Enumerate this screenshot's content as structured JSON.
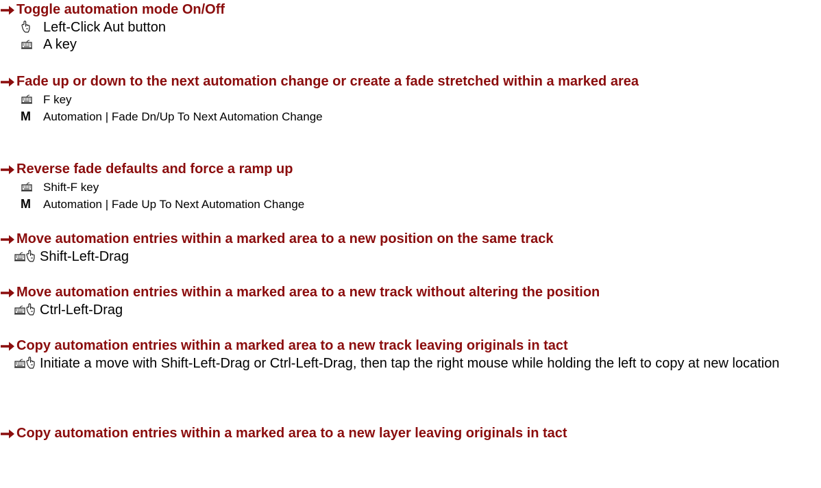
{
  "colors": {
    "heading": "#8b0d0d",
    "arrow": "#8b0d0d",
    "text": "#000000"
  },
  "icons": {
    "arrow": "right-arrow-icon",
    "mouse": "mouse-icon",
    "keyboard": "keyboard-icon"
  },
  "sections": [
    {
      "heading": "Toggle automation mode On/Off",
      "items": [
        {
          "icon": "mouse",
          "text": "Left-Click Aut button"
        },
        {
          "icon": "keyboard",
          "text": "A key"
        }
      ]
    },
    {
      "heading": "Fade up or down to the next automation change or create a fade stretched within a marked area",
      "items": [
        {
          "icon": "keyboard",
          "text": "F key"
        },
        {
          "icon": "menu",
          "menu_label": "M",
          "text": "Automation | Fade Dn/Up To Next Automation Change"
        }
      ]
    },
    {
      "heading": "Reverse fade defaults and force a ramp up",
      "items": [
        {
          "icon": "keyboard",
          "text": "Shift-F key"
        },
        {
          "icon": "menu",
          "menu_label": "M",
          "text": "Automation | Fade Up To Next Automation Change"
        }
      ]
    },
    {
      "heading": "Move automation entries within a marked area to a new position on the same track",
      "items": [
        {
          "icon": "keyboard+mouse",
          "text": "Shift-Left-Drag"
        }
      ]
    },
    {
      "heading": "Move automation entries within a marked area to a new track without altering the position",
      "items": [
        {
          "icon": "keyboard+mouse",
          "text": "Ctrl-Left-Drag"
        }
      ]
    },
    {
      "heading": "Copy automation entries within a marked area to a new track leaving originals in tact",
      "items": [
        {
          "icon": "keyboard+mouse",
          "text": "Initiate a move with Shift-Left-Drag or Ctrl-Left-Drag, then tap the right mouse while holding the left to copy at new location"
        }
      ]
    },
    {
      "heading": "Copy automation entries within a marked area to a new layer leaving originals in tact",
      "items": []
    }
  ]
}
